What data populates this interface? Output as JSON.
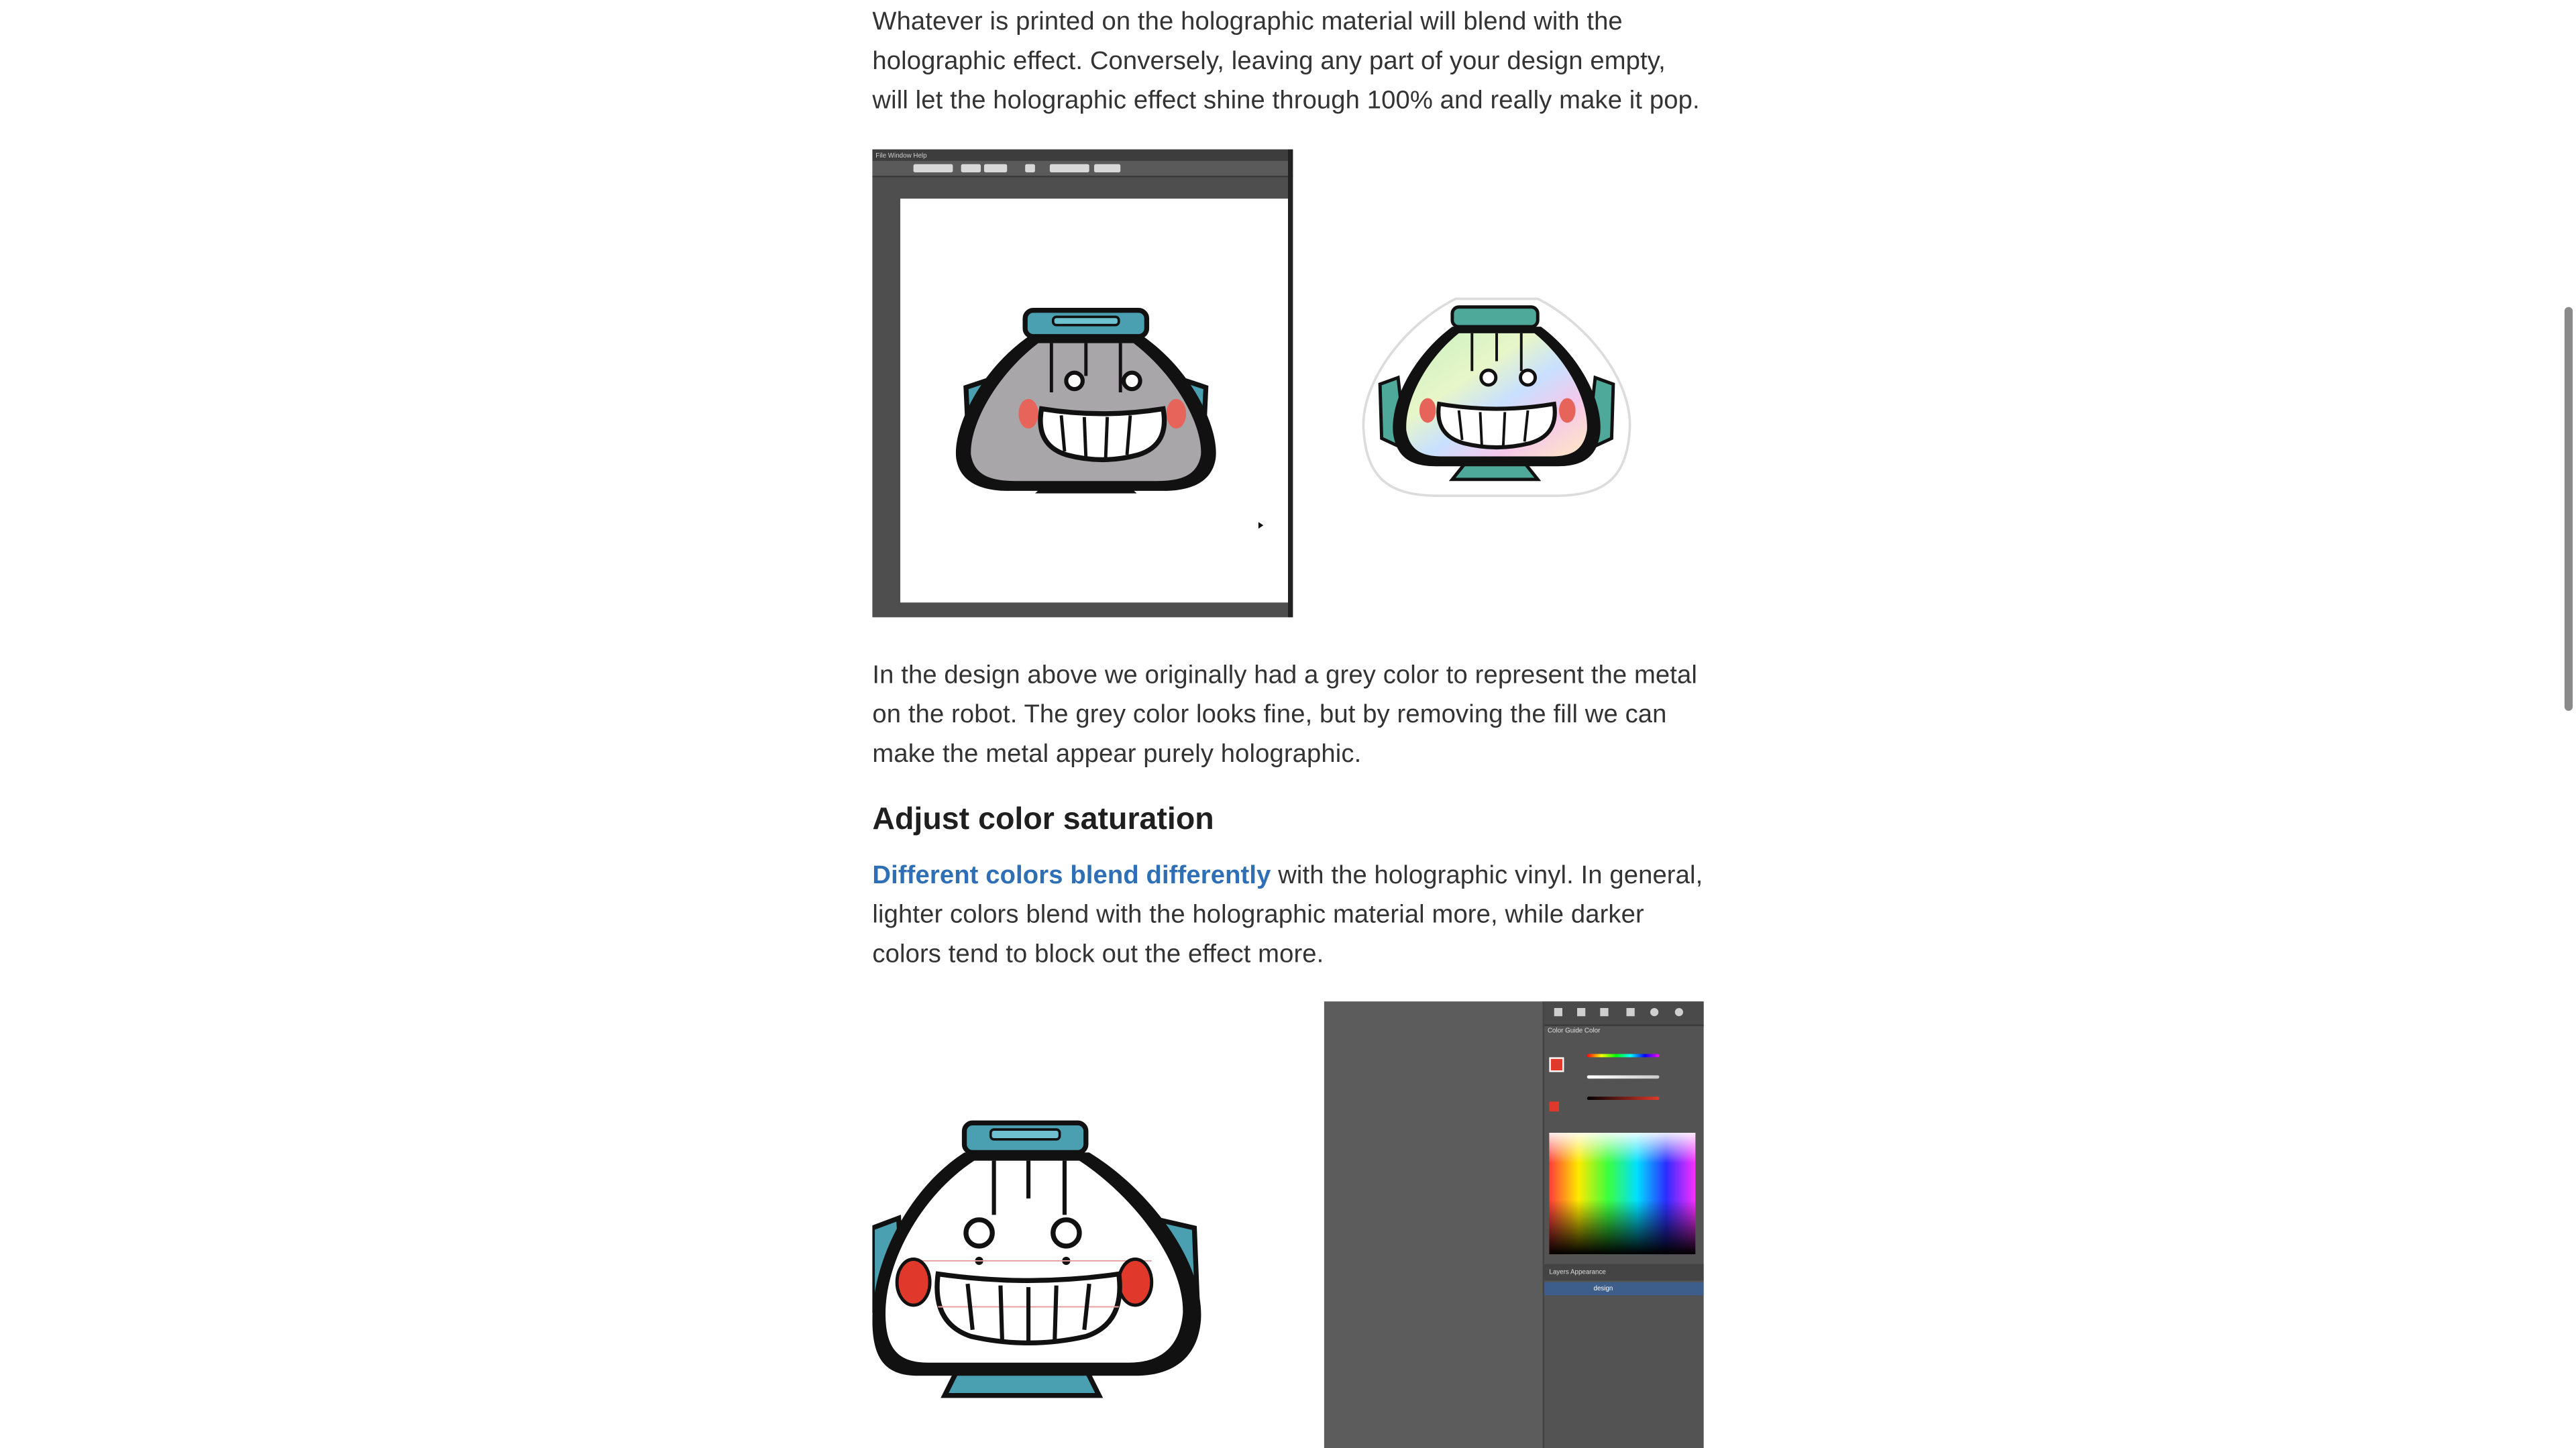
{
  "article": {
    "para1": "Whatever is printed on the holographic material will blend with the holographic effect. Conversely, leaving any part of your design empty, will let the holographic effect shine through 100% and really make it pop.",
    "para2": "In the design above we originally had a grey color to represent the metal on the robot. The grey color looks fine, but by removing the fill we can make the metal appear purely holographic.",
    "heading": "Adjust color saturation",
    "para3_link": "Different colors blend differently",
    "para3_rest": " with the holographic vinyl. In general, lighter colors blend with the holographic material more, while darker colors tend to block out the effect more."
  },
  "figure1": {
    "menu_items": "File  Window  Help",
    "layer_name": "design",
    "panel_tabs": "Color Guide   Color",
    "layers_tabs": "Layers    Appearance"
  },
  "colors": {
    "link": "#2f6fb6",
    "robot_teal": "#4a9fb0",
    "robot_cheek": "#e6645a",
    "robot_grey": "#a8a6a8"
  }
}
